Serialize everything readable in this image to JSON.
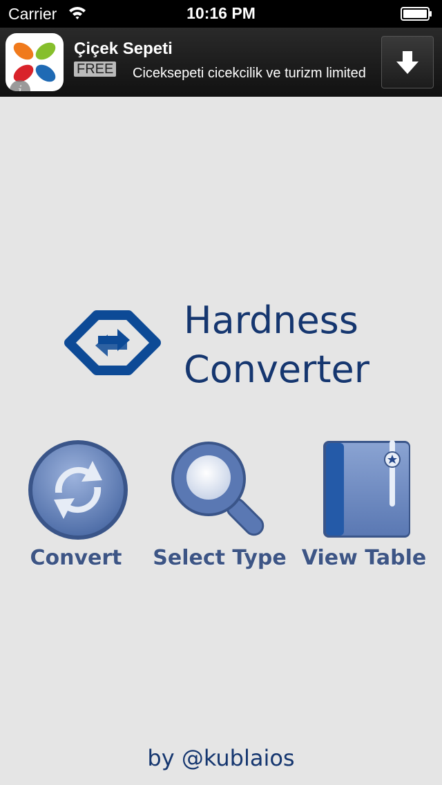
{
  "status_bar": {
    "carrier": "Carrier",
    "time": "10:16 PM"
  },
  "ad_banner": {
    "title": "Çiçek Sepeti",
    "price_badge": "FREE",
    "description": "Ciceksepeti cicekcilik ve turizm limited",
    "info_icon": "i"
  },
  "app": {
    "title_line1": "Hardness",
    "title_line2": "Converter"
  },
  "tools": [
    {
      "label": "Convert",
      "icon": "refresh-icon"
    },
    {
      "label": "Select Type",
      "icon": "magnifier-icon"
    },
    {
      "label": "View Table",
      "icon": "book-icon"
    }
  ],
  "footer": {
    "byline": "by @kublaios"
  },
  "colors": {
    "brand_blue": "#15366f",
    "label_blue": "#3d5585",
    "icon_blue": "#6f8fc7",
    "background": "#e5e5e5"
  }
}
